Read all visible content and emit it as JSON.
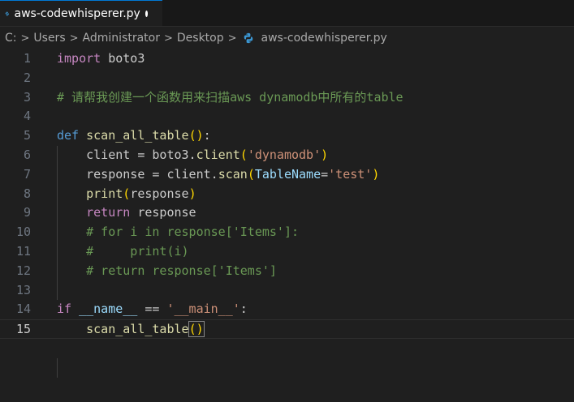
{
  "tab": {
    "label": "aws-codewhisperer.py"
  },
  "breadcrumb": [
    "C:",
    "Users",
    "Administrator",
    "Desktop",
    "aws-codewhisperer.py"
  ],
  "colors": {
    "keyword": "#569cd6",
    "control": "#c586c0",
    "function": "#dcdcaa",
    "string": "#ce9178",
    "comment": "#6a9955",
    "parameter": "#9cdcfe",
    "bracket": "#ffd700"
  },
  "code": {
    "line_numbers": [
      "1",
      "2",
      "3",
      "4",
      "5",
      "6",
      "7",
      "8",
      "9",
      "10",
      "11",
      "12",
      "13",
      "14",
      "15"
    ],
    "current_line": 15,
    "lines": [
      [
        {
          "t": "kw2",
          "v": "import"
        },
        {
          "t": "plain",
          "v": " boto3"
        }
      ],
      [],
      [
        {
          "t": "cm",
          "v": "# 请帮我创建一个函数用来扫描aws dynamodb中所有的table"
        }
      ],
      [],
      [
        {
          "t": "kw",
          "v": "def"
        },
        {
          "t": "plain",
          "v": " "
        },
        {
          "t": "fn",
          "v": "scan_all_table"
        },
        {
          "t": "br",
          "v": "()"
        },
        {
          "t": "plain",
          "v": ":"
        }
      ],
      [
        {
          "t": "plain",
          "v": "    client = boto3."
        },
        {
          "t": "fn",
          "v": "client"
        },
        {
          "t": "br",
          "v": "("
        },
        {
          "t": "str",
          "v": "'dynamodb'"
        },
        {
          "t": "br",
          "v": ")"
        }
      ],
      [
        {
          "t": "plain",
          "v": "    response = client."
        },
        {
          "t": "fn",
          "v": "scan"
        },
        {
          "t": "br",
          "v": "("
        },
        {
          "t": "param",
          "v": "TableName"
        },
        {
          "t": "plain",
          "v": "="
        },
        {
          "t": "str",
          "v": "'test'"
        },
        {
          "t": "br",
          "v": ")"
        }
      ],
      [
        {
          "t": "plain",
          "v": "    "
        },
        {
          "t": "fn",
          "v": "print"
        },
        {
          "t": "br",
          "v": "("
        },
        {
          "t": "plain",
          "v": "response"
        },
        {
          "t": "br",
          "v": ")"
        }
      ],
      [
        {
          "t": "plain",
          "v": "    "
        },
        {
          "t": "kw2",
          "v": "return"
        },
        {
          "t": "plain",
          "v": " response"
        }
      ],
      [
        {
          "t": "plain",
          "v": "    "
        },
        {
          "t": "cm",
          "v": "# for i in response['Items']:"
        }
      ],
      [
        {
          "t": "plain",
          "v": "    "
        },
        {
          "t": "cm",
          "v": "#     print(i)"
        }
      ],
      [
        {
          "t": "plain",
          "v": "    "
        },
        {
          "t": "cm",
          "v": "# return response['Items']"
        }
      ],
      [],
      [
        {
          "t": "kw2",
          "v": "if"
        },
        {
          "t": "plain",
          "v": " "
        },
        {
          "t": "param",
          "v": "__name__"
        },
        {
          "t": "plain",
          "v": " == "
        },
        {
          "t": "str",
          "v": "'__main__'"
        },
        {
          "t": "plain",
          "v": ":"
        }
      ],
      [
        {
          "t": "plain",
          "v": "    "
        },
        {
          "t": "fn",
          "v": "scan_all_table"
        },
        {
          "t": "br",
          "v": "()"
        }
      ]
    ]
  }
}
